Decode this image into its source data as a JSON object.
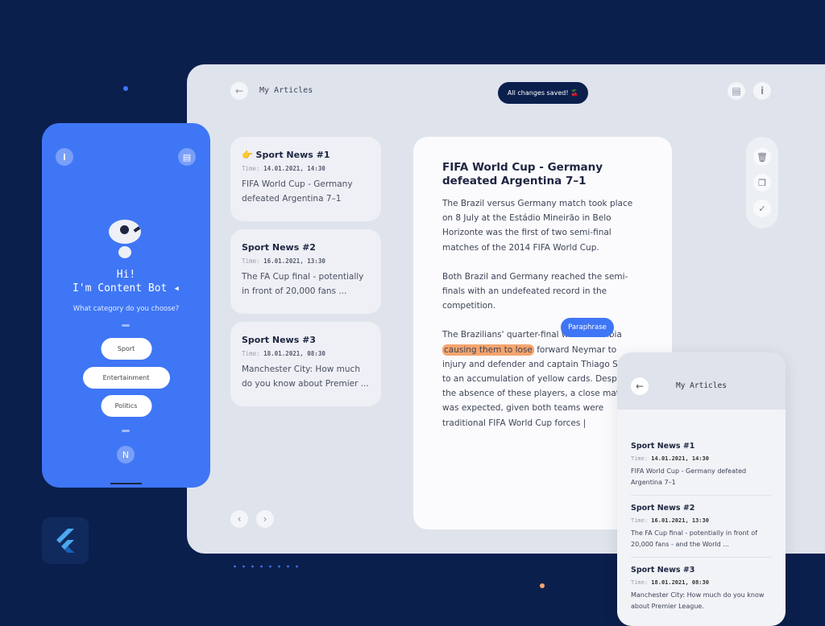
{
  "colors": {
    "background": "#0b1f4d",
    "accent": "#3f76f5",
    "highlight": "#f5a56e",
    "panel": "#dfe3ec"
  },
  "header": {
    "title": "My Articles",
    "toast": "All changes saved! 🍒",
    "icons": [
      "back-arrow-icon",
      "document-icon",
      "info-icon"
    ]
  },
  "articles": [
    {
      "title": "Sport News #1",
      "emoji": "👉",
      "time_label": "Time:",
      "time": "14.01.2021, 14:30",
      "desc": "FIFA World Cup - Germany defeated Argentina 7–1"
    },
    {
      "title": "Sport News #2",
      "time_label": "Time:",
      "time": "16.01.2021, 13:30",
      "desc": "The FA Cup final - potentially in front of 20,000 fans ..."
    },
    {
      "title": "Sport News #3",
      "time_label": "Time:",
      "time": "18.01.2021, 08:30",
      "desc": "Manchester City: How much do you know about Premier ..."
    }
  ],
  "editor": {
    "title": "FIFA World Cup - Germany defeated Argentina 7–1",
    "p1": "The Brazil versus Germany match took place on 8 July at the Estádio Mineirão in Belo Horizonte was the first of two semi-final matches of the 2014 FIFA World Cup.",
    "p2": "Both Brazil and Germany reached the semi-finals with an undefeated record in the competition.",
    "p3a": "The Brazilians' quarter-final with Colombia ",
    "p3hl": "causing them to lose",
    "p3b": " forward Neymar to injury and defender and captain Thiago Silva to an accumulation of yellow cards. Despite the absence of these players, a close match was expected, given both teams were traditional FIFA World Cup forces |",
    "tooltip": "Paraphrase"
  },
  "actions": [
    "delete-icon",
    "copy-icon",
    "check-icon"
  ],
  "phone": {
    "greeting": "Hi!",
    "bot": "I'm Content Bot",
    "question": "What category do you choose?",
    "options": [
      "Sport",
      "Entertainment",
      "Politics"
    ],
    "bottom_icon": "N"
  },
  "mobile": {
    "title": "My Articles",
    "items": [
      {
        "title": "Sport News #1",
        "time_label": "Time:",
        "time": "14.01.2021, 14:30",
        "desc": "FIFA World Cup - Germany defeated Argentina 7–1"
      },
      {
        "title": "Sport News #2",
        "time_label": "Time:",
        "time": "16.01.2021, 13:30",
        "desc": "The FA Cup final - potentially in front of 20,000 fans - and the World ..."
      },
      {
        "title": "Sport News #3",
        "time_label": "Time:",
        "time": "18.01.2021, 08:30",
        "desc": "Manchester City: How much do you know about Premier League."
      }
    ]
  }
}
